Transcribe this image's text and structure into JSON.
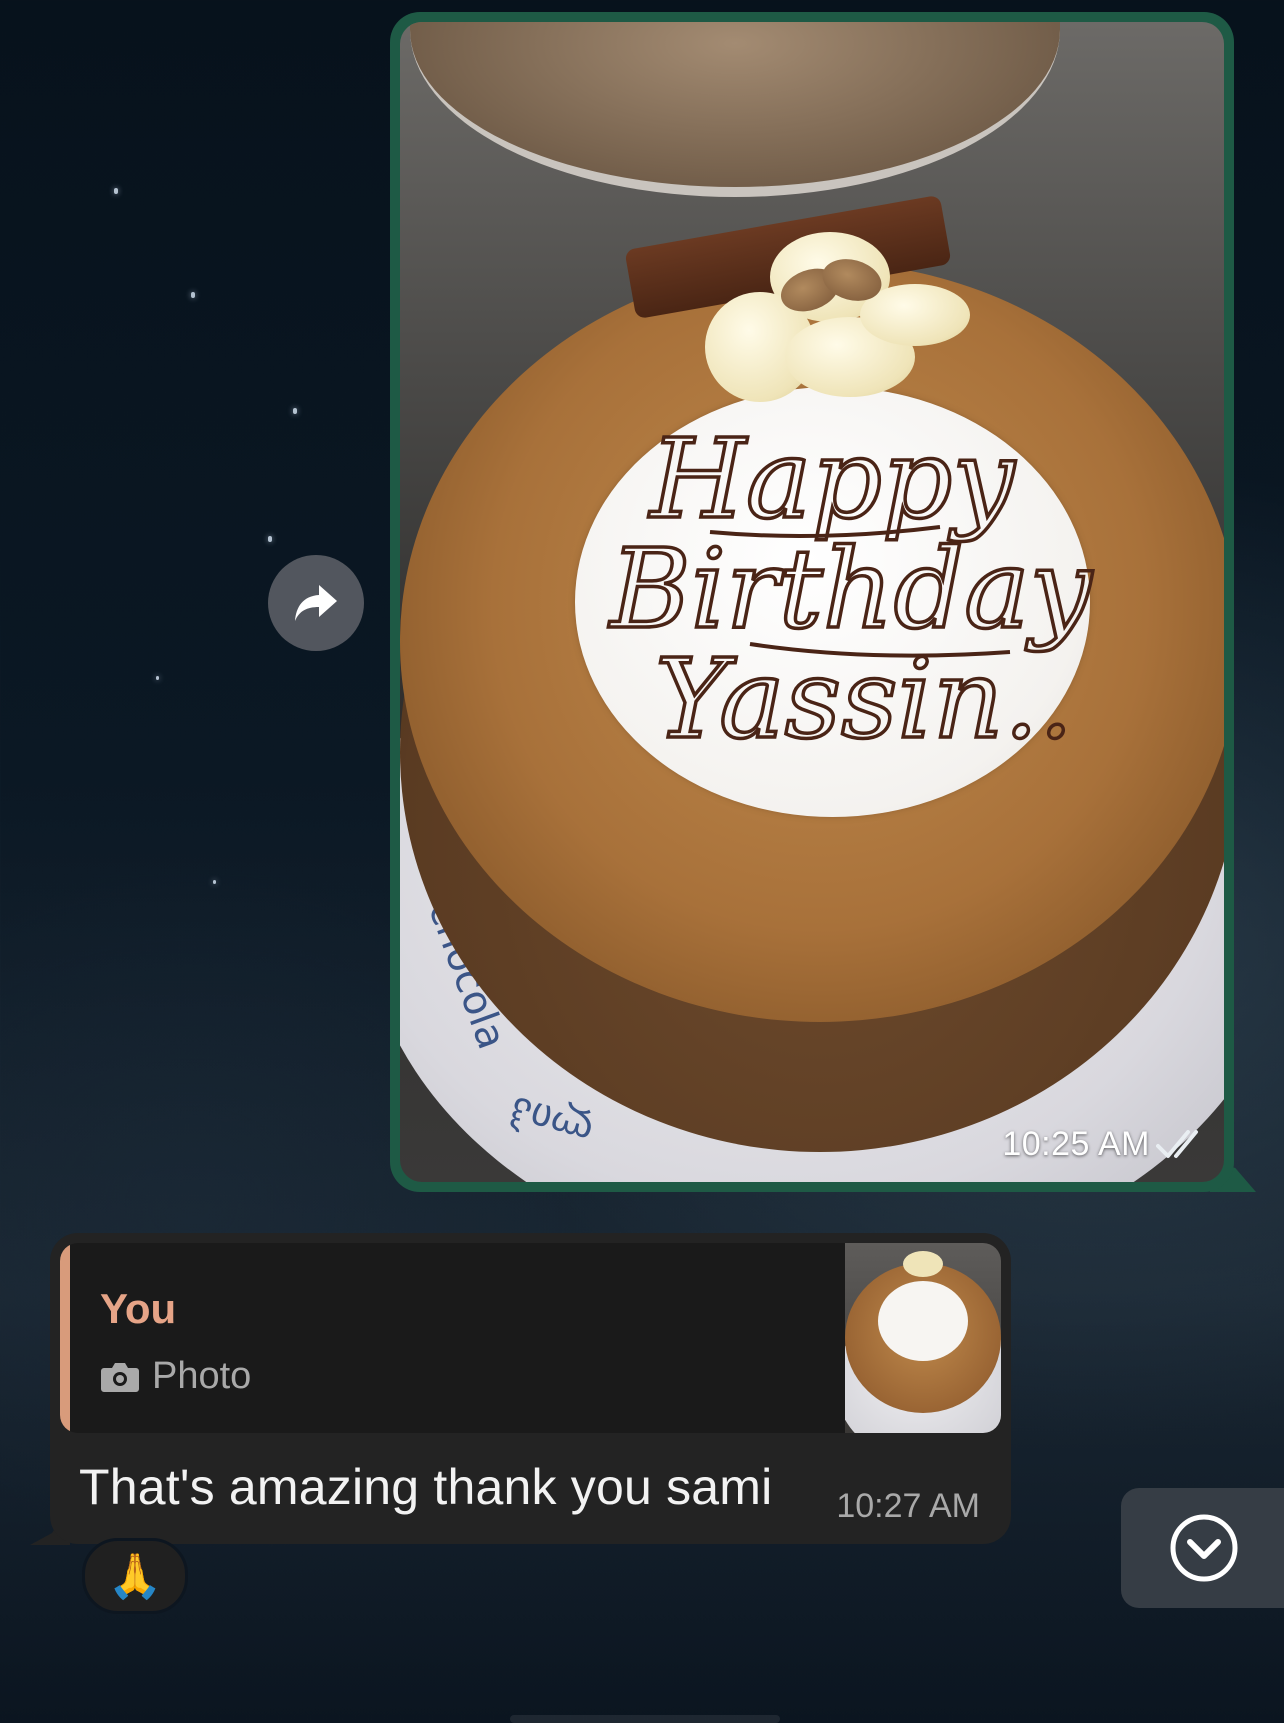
{
  "outgoing_message": {
    "type": "photo",
    "time": "10:25 AM",
    "status": "read",
    "status_icon": "double-check-icon",
    "photo_inscription": [
      "Happy",
      "Birthday",
      "Yassin.."
    ],
    "accent_color": "#1e5a45"
  },
  "forward_button": {
    "icon": "forward-arrow-icon"
  },
  "reply_message": {
    "quoted": {
      "author": "You",
      "type_icon": "camera-icon",
      "type_label": "Photo",
      "author_color": "#e6a487"
    },
    "text": "That's amazing thank you sami",
    "time": "10:27 AM",
    "reaction": "🙏"
  },
  "scroll_down_button": {
    "icon": "chevron-down-icon"
  }
}
